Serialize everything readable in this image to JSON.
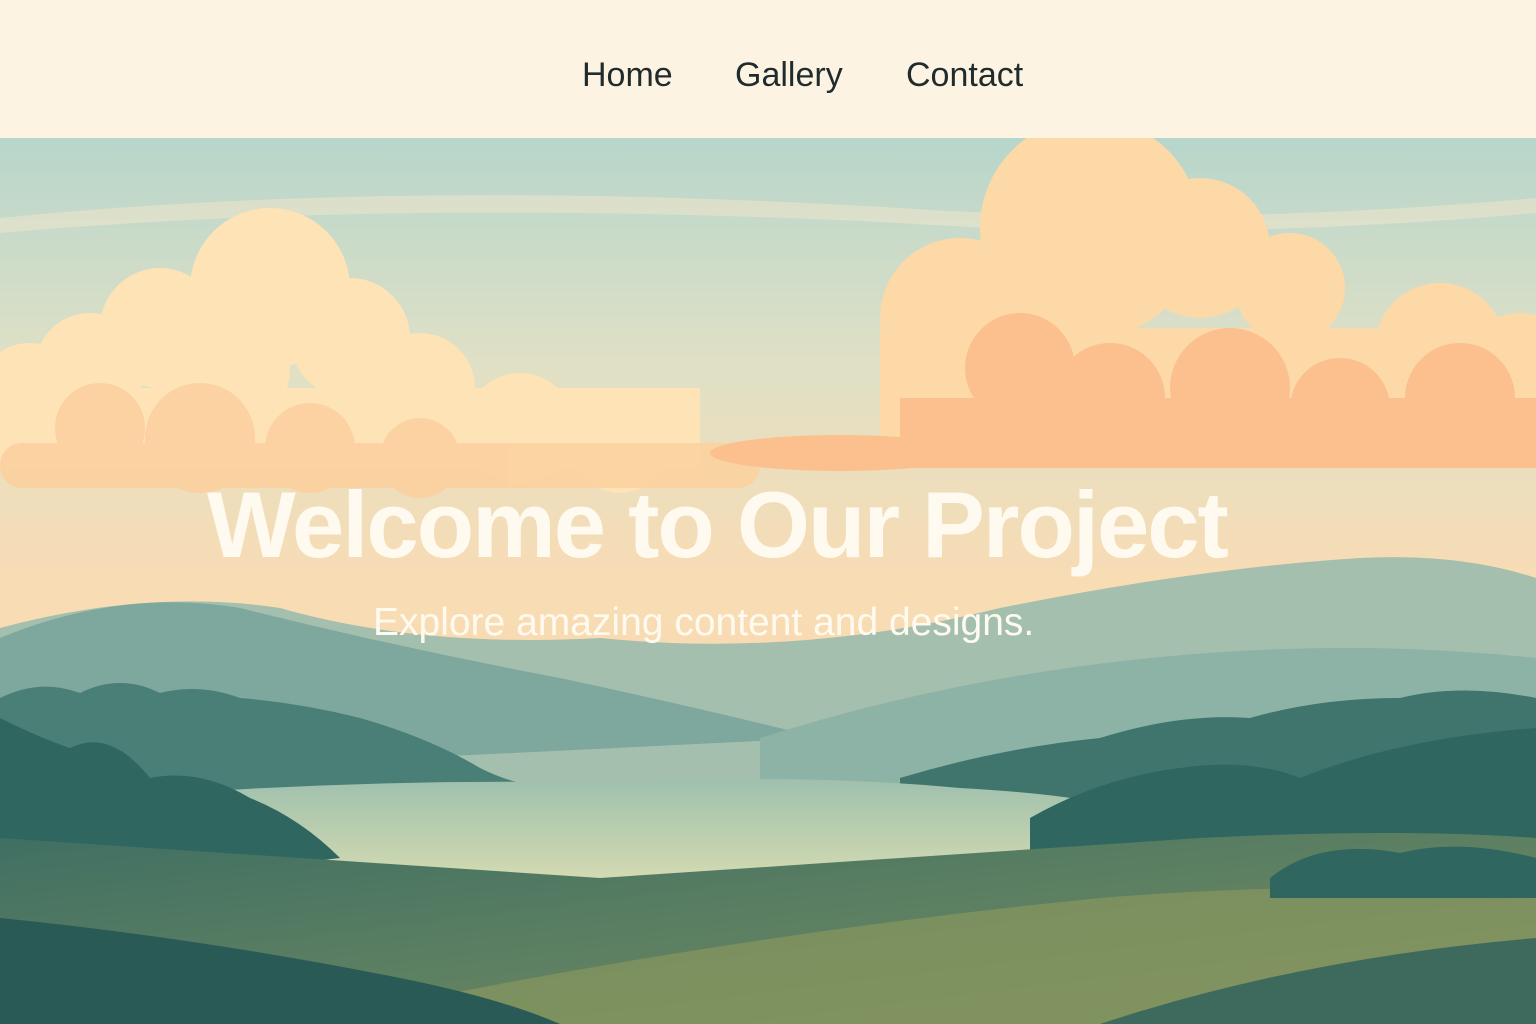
{
  "nav": {
    "items": [
      {
        "label": "Home"
      },
      {
        "label": "Gallery"
      },
      {
        "label": "Contact"
      }
    ]
  },
  "hero": {
    "title": "Welcome to Our Project",
    "subtitle": "Explore amazing content and designs."
  },
  "colors": {
    "header_bg": "#fdf3e3",
    "nav_text": "#1f2b2c",
    "sky_top": "#b7d6cb",
    "cloud_light": "#fde0b0",
    "cloud_peach": "#fcc08c",
    "hill_far": "#9ab9ad",
    "hill_mid": "#5f958f",
    "forest": "#2f6660",
    "lake": "#c6d6b3",
    "meadow": "#6f8a5e",
    "hero_text": "#fffaf0"
  }
}
